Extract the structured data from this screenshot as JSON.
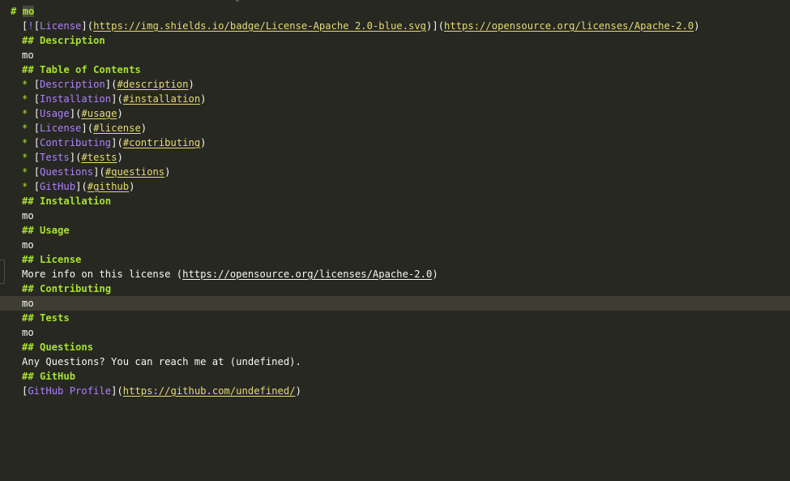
{
  "h1": {
    "prefix": "# ",
    "text": "mo"
  },
  "badge": {
    "open": "[",
    "bang": "!",
    "inner_open": "[",
    "alt": "License",
    "inner_close": "]",
    "paren_open": "(",
    "img_url": "https://img.shields.io/badge/License-Apache_2.0-blue.svg",
    "paren_close": ")",
    "close": "]",
    "link_open": "(",
    "link_url": "https://opensource.org/licenses/Apache-2.0",
    "link_close": ")"
  },
  "sections": {
    "description": {
      "heading": "## Description",
      "body": "mo"
    },
    "toc": {
      "heading": "## Table of Contents"
    },
    "installation": {
      "heading": "## Installation",
      "body": "mo"
    },
    "usage": {
      "heading": "## Usage",
      "body": "mo"
    },
    "license": {
      "heading": "## License",
      "body_prefix": "More info on this license (",
      "body_url": "https://opensource.org/licenses/Apache-2.0",
      "body_suffix": ")"
    },
    "contributing": {
      "heading": "## Contributing",
      "body": "mo"
    },
    "tests": {
      "heading": "## Tests",
      "body": "mo"
    },
    "questions": {
      "heading": "## Questions",
      "body": "Any Questions? You can reach me at (undefined)."
    },
    "github": {
      "heading": "## GitHub",
      "link_text": "GitHub Profile",
      "link_url": "https://github.com/undefined/"
    }
  },
  "toc_items": [
    {
      "bullet": "* ",
      "text": "Description",
      "anchor": "#description"
    },
    {
      "bullet": "* ",
      "text": "Installation",
      "anchor": "#installation"
    },
    {
      "bullet": "* ",
      "text": "Usage",
      "anchor": "#usage"
    },
    {
      "bullet": "* ",
      "text": "License",
      "anchor": "#license"
    },
    {
      "bullet": "* ",
      "text": "Contributing",
      "anchor": "#contributing"
    },
    {
      "bullet": "* ",
      "text": "Tests",
      "anchor": "#tests"
    },
    {
      "bullet": "* ",
      "text": "Questions",
      "anchor": "#questions"
    },
    {
      "bullet": "* ",
      "text": "GitHub",
      "anchor": "#github"
    }
  ],
  "punct": {
    "lb": "[",
    "rb": "]",
    "lp": "(",
    "rp": ")"
  },
  "colors": {
    "background": "#272822",
    "heading": "#a6e22e",
    "link_text": "#ae81ff",
    "url": "#e6db74",
    "current_line": "#3e3d32"
  }
}
